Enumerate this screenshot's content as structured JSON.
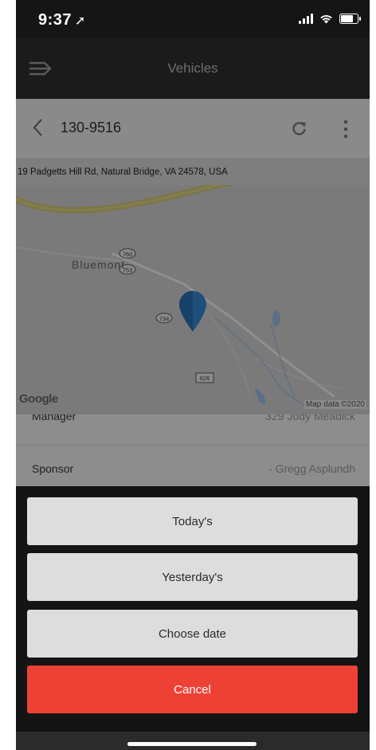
{
  "status_bar": {
    "time": "9:37",
    "location_arrow": "➚"
  },
  "header": {
    "title": "Vehicles",
    "menu_icon": "menu-arrow-icon"
  },
  "vehicle": {
    "id": "130-9516",
    "address": "19 Padgetts Hill Rd, Natural Bridge, VA 24578, USA"
  },
  "map": {
    "place_label": "Bluemont",
    "route_labels": [
      "760",
      "753",
      "734",
      "626"
    ],
    "google_logo": "Google",
    "credit": "Map data ©2020"
  },
  "info_rows": [
    {
      "label": "Manager",
      "value": "329 Jody Meadick"
    },
    {
      "label": "Sponsor",
      "value": "- Gregg Asplundh"
    }
  ],
  "action_sheet": {
    "today": "Today's",
    "yesterday": "Yesterday's",
    "choose_date": "Choose date",
    "cancel": "Cancel"
  },
  "colors": {
    "cancel": "#ee4135",
    "sheet_button": "#dddddd",
    "marker": "#1f4f7a"
  }
}
